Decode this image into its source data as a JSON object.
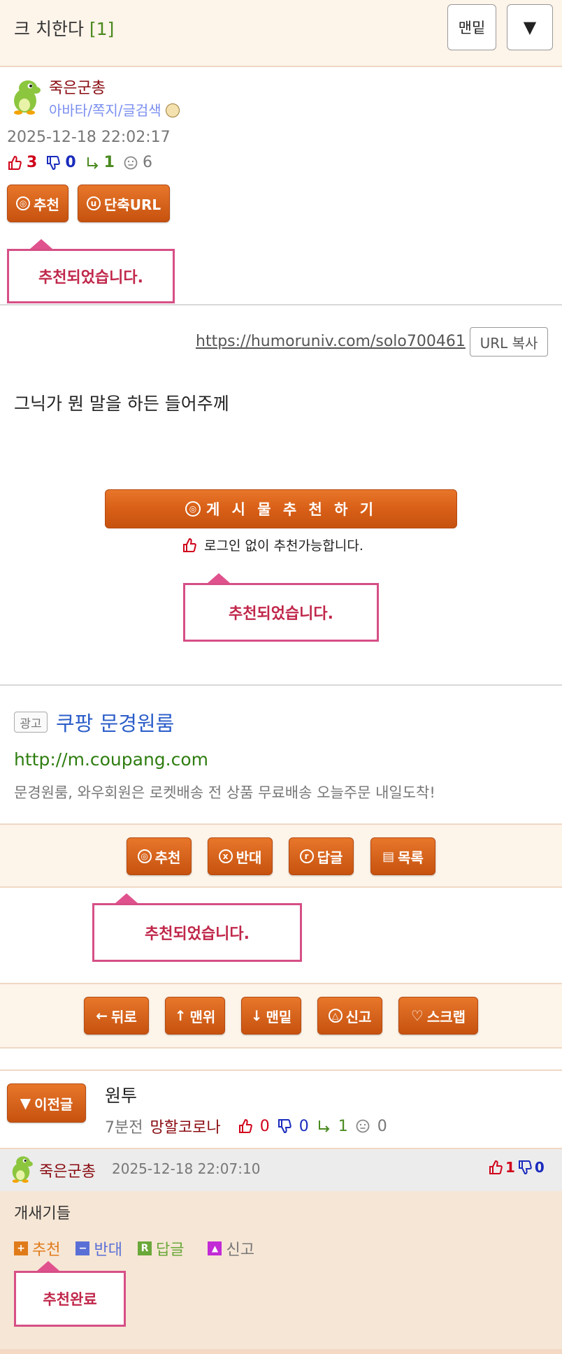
{
  "header": {
    "title": "크 치한다",
    "count": "[1]",
    "bottom_button": "맨밑",
    "menu_button": "▼"
  },
  "author": {
    "name": "죽은군총",
    "links": "아바타/쪽지/글검색",
    "date": "2025-12-18 22:02:17",
    "up": "3",
    "down": "0",
    "reply": "1",
    "views": "6"
  },
  "action_buttons": {
    "recommend": "추천",
    "short_url": "단축URL"
  },
  "notice": "추천되었습니다.",
  "url_bar": {
    "url": "https://humoruniv.com/solo700461",
    "copy": "URL 복사"
  },
  "post": {
    "content": "그닉가 뭔 말을 하든 들어주께",
    "recommend_big": "게 시 물   추 천 하 기",
    "recommend_note": "로그인 없이 추천가능합니다."
  },
  "ad": {
    "tag": "광고",
    "title": "쿠팡 문경원룸",
    "url": "http://m.coupang.com",
    "desc": "문경원룸, 와우회원은 로켓배송 전 상품 무료배송 오늘주문 내일도착!"
  },
  "bar1": {
    "recommend": "추천",
    "oppose": "반대",
    "reply": "답글",
    "list": "목록"
  },
  "bar2": {
    "back": "뒤로",
    "top": "맨위",
    "bottom": "맨밑",
    "report": "신고",
    "scrap": "스크랩"
  },
  "prev_post": {
    "button": "이전글",
    "title": "원투",
    "ago": "7분전",
    "nick": "망할코로나",
    "up": "0",
    "down": "0",
    "reply": "1",
    "views": "0"
  },
  "comment": {
    "name": "죽은군총",
    "date": "2025-12-18 22:07:10",
    "up": "1",
    "down": "0",
    "text": "개새기들",
    "recommend": "추천",
    "oppose": "반대",
    "reply": "답글",
    "report": "신고",
    "done_notice": "추천완료"
  },
  "colors": {
    "accent_orange": "#d85f17",
    "notice_pink": "#d64f86",
    "up_red": "#d0021b",
    "down_blue": "#1a2bbd",
    "reply_green": "#4a8a1f"
  }
}
